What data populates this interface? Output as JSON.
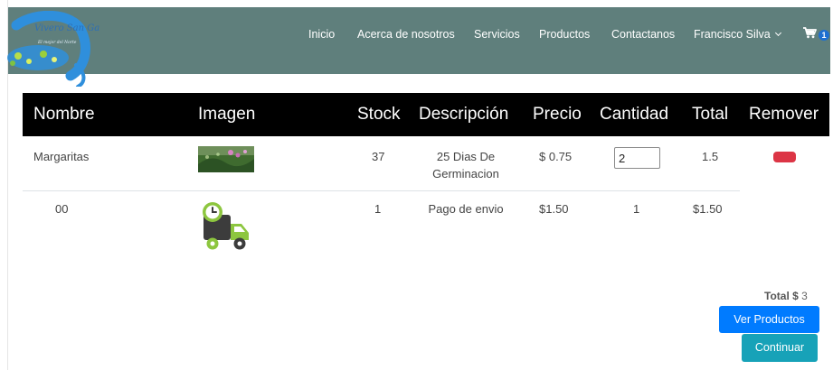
{
  "brand": {
    "logo_text": "Vivero San Gabriel",
    "logo_subtext": "El mejor del Norte"
  },
  "nav": {
    "items": [
      "Inicio",
      "Acerca de nosotros",
      "Servicios",
      "Productos",
      "Contactanos"
    ],
    "user": "Francisco Silva",
    "cart_count": "1"
  },
  "table": {
    "headers": [
      "Nombre",
      "Imagen",
      "Stock",
      "Descripción",
      "Precio",
      "Cantidad",
      "Total",
      "Remover"
    ],
    "rows": [
      {
        "name": "Margaritas",
        "image": "flower-photo",
        "stock": "37",
        "description_line1": "25 Dias De",
        "description_line2": "Germinacion",
        "price": "$ 0.75",
        "quantity": "2",
        "total": "1.5"
      },
      {
        "name": "00",
        "image": "delivery-truck-icon",
        "stock": "1",
        "description_line1": "Pago de envio",
        "description_line2": "",
        "price": "$1.50",
        "quantity": "1",
        "total": "$1.50"
      }
    ]
  },
  "summary": {
    "total_label": "Total $",
    "total_value": "3"
  },
  "buttons": {
    "ver_productos": "Ver Productos",
    "continuar": "Continuar"
  },
  "colors": {
    "navbar": "#5f7f7c",
    "header": "#000000",
    "remove": "#dc3545",
    "primary": "#007bff",
    "info": "#17a2b8",
    "truck_green": "#8dc63f",
    "truck_dark": "#3c3c3c"
  }
}
